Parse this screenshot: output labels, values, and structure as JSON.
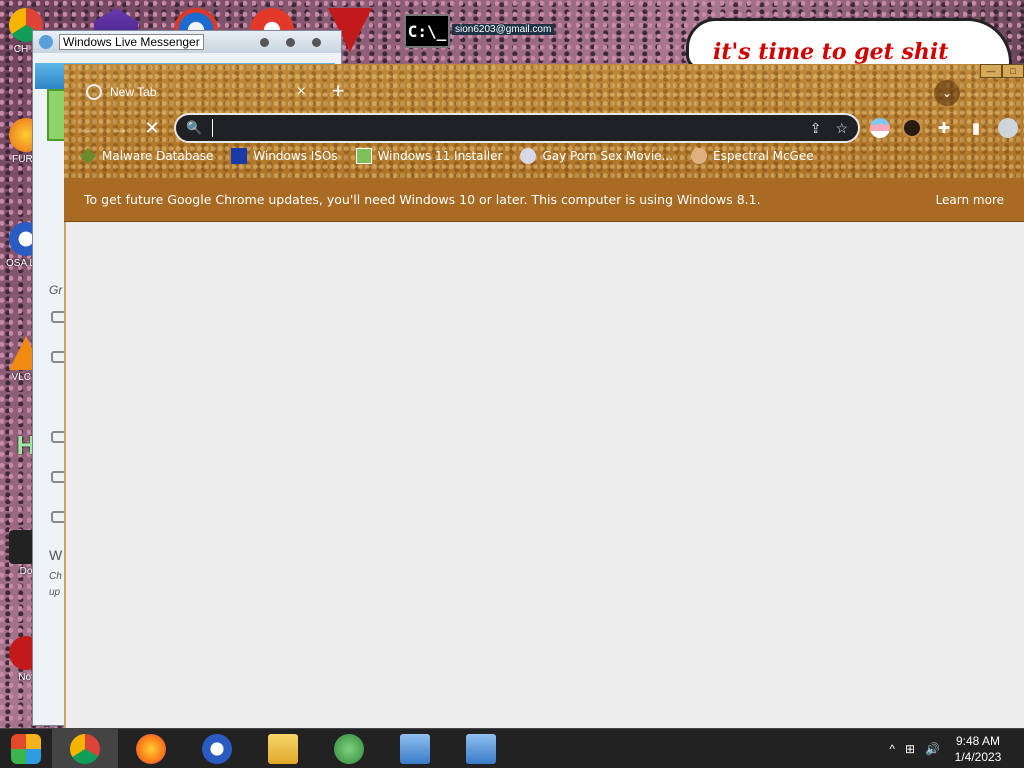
{
  "desktop": {
    "icons": [
      {
        "label": "CH D",
        "color": "#2a8c3a"
      },
      {
        "label": "FURR",
        "color": "#e86a1a"
      },
      {
        "label": "OSA LAD",
        "color": "#2a5bc2"
      },
      {
        "label": "VLC P",
        "color": "#f08a10"
      },
      {
        "label": "H",
        "color": "#2ea84a"
      },
      {
        "label": "Do",
        "color": "#111111"
      },
      {
        "label": "Not",
        "color": "#c21a1a"
      }
    ],
    "cmd_label": "C:\\_",
    "wallpaper_text": "it's time to get shit"
  },
  "messenger": {
    "title": "Windows Live Messenger",
    "email": "sion6203@gmail.com",
    "partial_texts": [
      "Gr",
      "W",
      "Ch",
      "up"
    ]
  },
  "chrome": {
    "tab": {
      "title": "New Tab",
      "close": "×"
    },
    "new_tab": "+",
    "tab_search": "⌄",
    "toolbar": {
      "back": "←",
      "forward": "→",
      "stop": "✕",
      "omnibox_value": "",
      "omnibox_placeholder": "",
      "search_glyph": "🔍",
      "share_glyph": "⇪",
      "star_glyph": "☆"
    },
    "extensions": {
      "puzzle": "✚",
      "sidepanel": "▮"
    },
    "bookmarks": [
      {
        "label": "Malware Database",
        "icon": "malware-icon",
        "color": "#6b8a2a"
      },
      {
        "label": "Windows ISOs",
        "icon": "windows-x-icon",
        "color": "#1a3aa8"
      },
      {
        "label": "Windows 11 Installer",
        "icon": "installer-icon",
        "color": "#7fbf5a"
      },
      {
        "label": "Gay Porn Sex Movie...",
        "icon": "site-icon",
        "color": "#d8d8e8"
      },
      {
        "label": "Espectral McGee",
        "icon": "face-icon",
        "color": "#e0b080"
      }
    ],
    "infobar": {
      "message": "To get future Google Chrome updates, you'll need Windows 10 or later. This computer is using Windows 8.1.",
      "learn_more": "Learn more"
    },
    "window_controls": {
      "minimize": "—",
      "maximize": "□"
    }
  },
  "taskbar": {
    "items": [
      {
        "name": "chrome",
        "color": "#dd4b3e",
        "active": true
      },
      {
        "name": "firefox",
        "color": "#ff7a18",
        "active": false
      },
      {
        "name": "osa",
        "color": "#2a5bc2",
        "active": false
      },
      {
        "name": "file-explorer",
        "color": "#f0c24a",
        "active": false
      },
      {
        "name": "messenger",
        "color": "#4fa04f",
        "active": false
      },
      {
        "name": "installer-1",
        "color": "#3a7ac8",
        "active": false
      },
      {
        "name": "installer-2",
        "color": "#3a7ac8",
        "active": false
      }
    ],
    "tray": {
      "chevron": "^",
      "network": "⊞",
      "volume": "🔊",
      "time": "9:48 AM",
      "date": "1/4/2023"
    }
  }
}
